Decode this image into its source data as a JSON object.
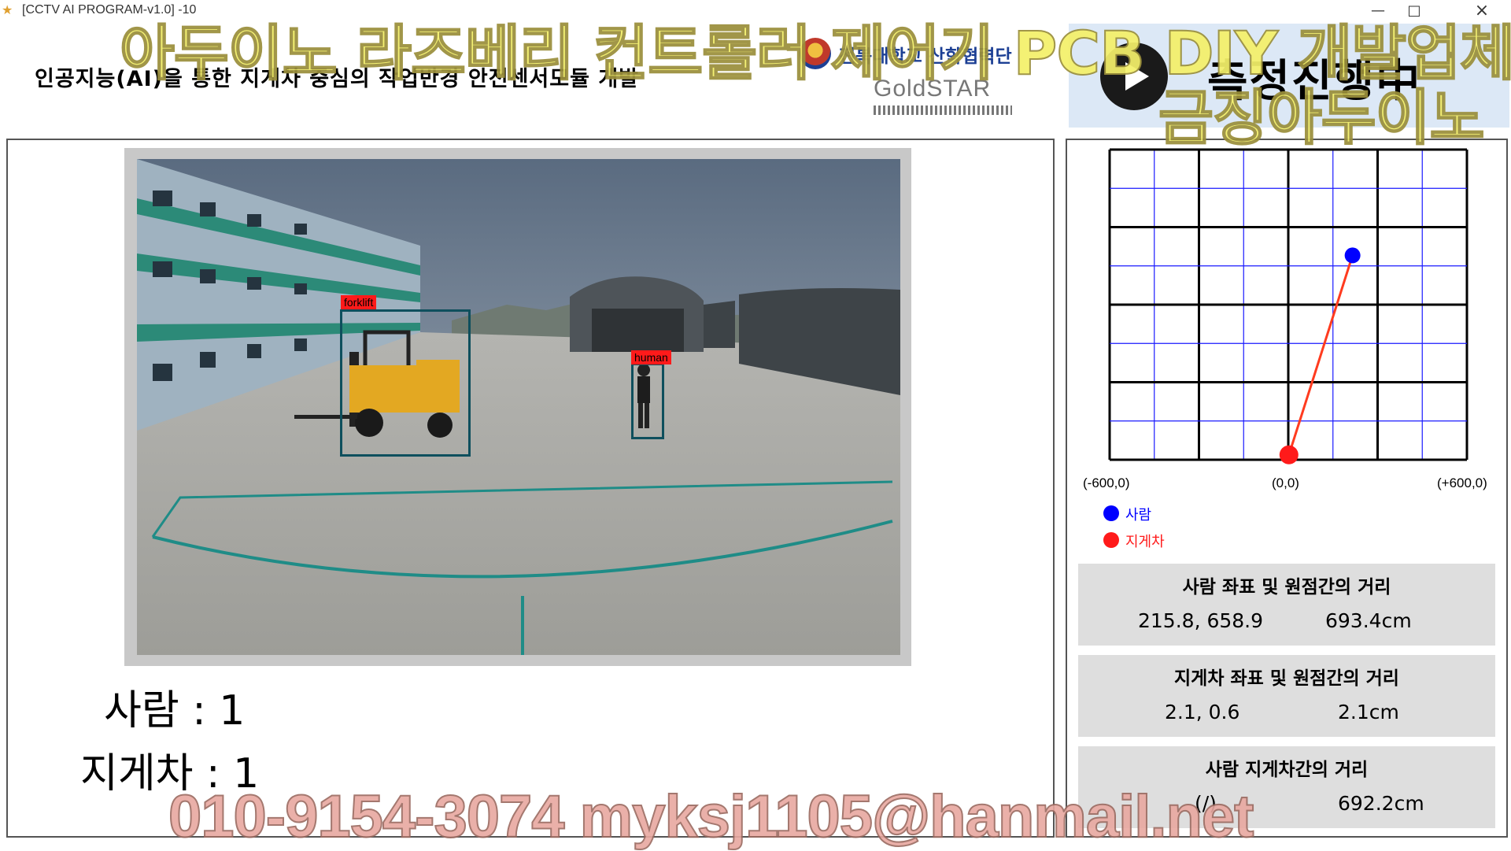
{
  "window": {
    "title": "[CCTV AI PROGRAM-v1.0] -10",
    "minimize": "—",
    "maximize": "□",
    "close": "×"
  },
  "header": {
    "subtitle": "인공지능(AI)을 통한 지게차 중심의 작업반경 안전센서모듈 개발",
    "university": "전북대학교 산학협력단",
    "goldstar_logo": "GoldSTAR",
    "status": "측정진행中"
  },
  "overlays": {
    "top": "아두이노 라즈베리 컨트롤러 제어기 PCB DIY 개발업체",
    "right": "금징아두이노",
    "bottom": "010-9154-3074 myksj1105@hanmail.net"
  },
  "camera": {
    "detections": [
      {
        "label": "forklift",
        "color": "#ff1a1a"
      },
      {
        "label": "human",
        "color": "#ff1a1a"
      }
    ]
  },
  "counts": {
    "person": "사람 : 1",
    "forklift": "지게차 : 1"
  },
  "plot": {
    "axis_min": "(-600,0)",
    "axis_zero": "(0,0)",
    "axis_max": "(+600,0)",
    "x_range": [
      -600,
      600
    ],
    "y_range": [
      0,
      1000
    ],
    "person_point": {
      "x": 215.8,
      "y": 658.9,
      "color": "#0000ff"
    },
    "forklift_point": {
      "x": 2.1,
      "y": 0.6,
      "color": "#ff1a1a"
    }
  },
  "legend": {
    "person": "사람",
    "forklift": "지게차"
  },
  "info": {
    "person": {
      "title": "사람 좌표 및 원점간의 거리",
      "coords": "215.8, 658.9",
      "distance": "693.4cm"
    },
    "forklift": {
      "title": "지게차 좌표 및 원점간의 거리",
      "coords": "2.1, 0.6",
      "distance": "2.1cm"
    },
    "between": {
      "title": "사람 지게차간의 거리",
      "coords": "(/)",
      "distance": "692.2cm"
    }
  }
}
